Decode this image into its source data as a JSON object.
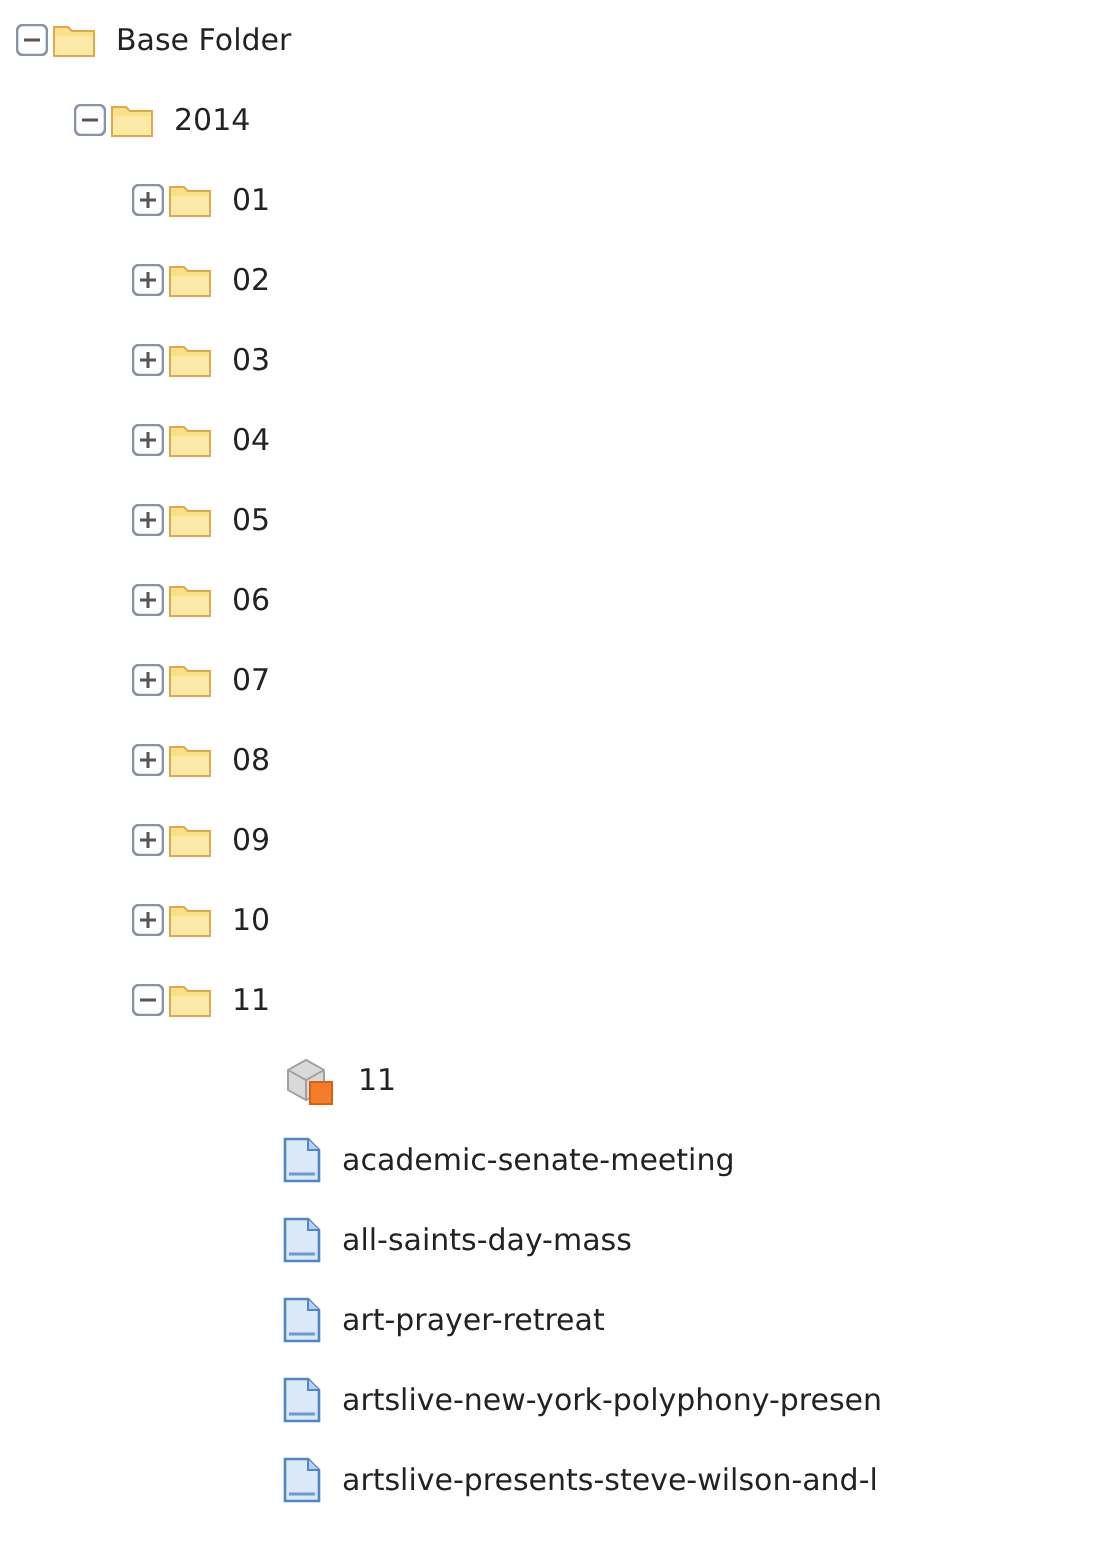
{
  "tree": [
    {
      "kind": "folder",
      "label": "Base Folder",
      "expanded": true,
      "children": [
        {
          "kind": "folder",
          "label": "2014",
          "expanded": true,
          "children": [
            {
              "kind": "folder",
              "label": "01",
              "expanded": false
            },
            {
              "kind": "folder",
              "label": "02",
              "expanded": false
            },
            {
              "kind": "folder",
              "label": "03",
              "expanded": false
            },
            {
              "kind": "folder",
              "label": "04",
              "expanded": false
            },
            {
              "kind": "folder",
              "label": "05",
              "expanded": false
            },
            {
              "kind": "folder",
              "label": "06",
              "expanded": false
            },
            {
              "kind": "folder",
              "label": "07",
              "expanded": false
            },
            {
              "kind": "folder",
              "label": "08",
              "expanded": false
            },
            {
              "kind": "folder",
              "label": "09",
              "expanded": false
            },
            {
              "kind": "folder",
              "label": "10",
              "expanded": false
            },
            {
              "kind": "folder",
              "label": "11",
              "expanded": true,
              "children": [
                {
                  "kind": "package",
                  "label": "11"
                },
                {
                  "kind": "page",
                  "label": "academic-senate-meeting"
                },
                {
                  "kind": "page",
                  "label": "all-saints-day-mass"
                },
                {
                  "kind": "page",
                  "label": "art-prayer-retreat"
                },
                {
                  "kind": "page",
                  "label": "artslive-new-york-polyphony-presen"
                },
                {
                  "kind": "page",
                  "label": "artslive-presents-steve-wilson-and-l"
                }
              ]
            }
          ]
        }
      ]
    }
  ]
}
